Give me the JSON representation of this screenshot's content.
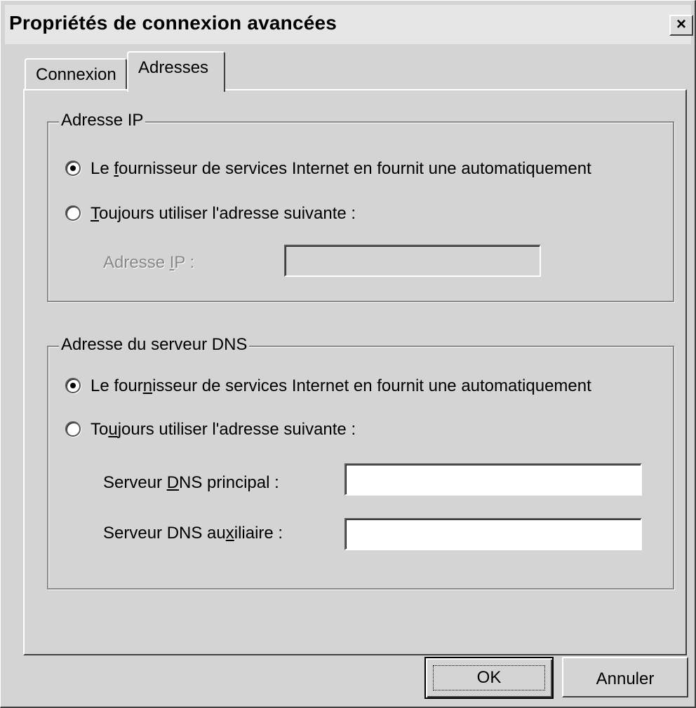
{
  "window": {
    "title": "Propriétés de connexion avancées",
    "close_glyph": "×"
  },
  "tabs": [
    {
      "label": "Connexion",
      "active": false
    },
    {
      "label": "Adresses",
      "active": true
    }
  ],
  "ip_group": {
    "legend": "Adresse IP",
    "option_auto": {
      "prefix": "Le ",
      "mnemonic": "f",
      "suffix": "ournisseur de services Internet en fournit une automatiquement",
      "selected": true
    },
    "option_manual": {
      "prefix": "",
      "mnemonic": "T",
      "suffix": "oujours utiliser l'adresse suivante :",
      "selected": false
    },
    "field_label": {
      "prefix": "Adresse ",
      "mnemonic": "I",
      "suffix": "P :"
    },
    "field_value": ""
  },
  "dns_group": {
    "legend": "Adresse du serveur DNS",
    "option_auto": {
      "prefix": "Le four",
      "mnemonic": "n",
      "suffix": "isseur de services Internet en fournit une automatiquement",
      "selected": true
    },
    "option_manual": {
      "prefix": "To",
      "mnemonic": "u",
      "suffix": "jours utiliser l'adresse suivante :",
      "selected": false
    },
    "primary_label": {
      "prefix": "Serveur ",
      "mnemonic": "D",
      "suffix": "NS principal :"
    },
    "primary_value": "",
    "secondary_label": {
      "prefix": "Serveur DNS au",
      "mnemonic": "x",
      "suffix": "iliaire :"
    },
    "secondary_value": ""
  },
  "buttons": {
    "ok": "OK",
    "cancel": "Annuler"
  }
}
